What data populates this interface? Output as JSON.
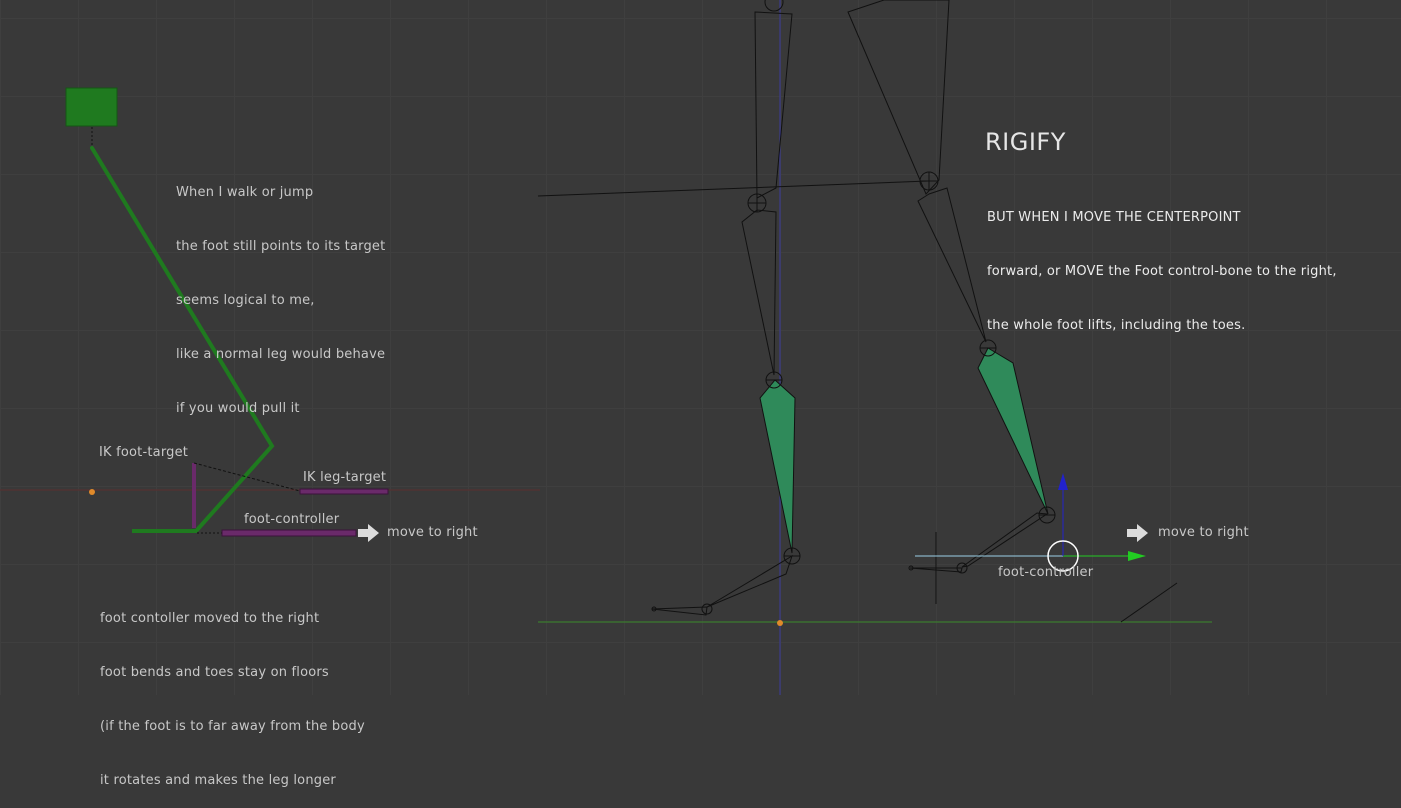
{
  "left_panel": {
    "note_top": [
      "When I walk or jump",
      "the foot still points to its target",
      "seems logical to me,",
      "like a normal leg would behave",
      "if you would pull it"
    ],
    "ik_foot_target_label": "IK foot-target",
    "ik_leg_target_label": "IK leg-target",
    "foot_controller_label": "foot-controller",
    "move_right_label": "move to right",
    "note_bottom": [
      "foot contoller moved to the right",
      "foot bends and toes stay on floors",
      "(if the foot is to far away from the body",
      "it rotates and makes the leg longer"
    ]
  },
  "right_panel": {
    "title": "RIGIFY",
    "note": [
      "BUT WHEN I MOVE THE CENTERPOINT",
      "forward, or MOVE the Foot control-bone to the right,",
      "the whole foot lifts, including the toes."
    ],
    "move_right_label": "move to right",
    "foot_controller_label": "foot-controller"
  },
  "colors": {
    "background": "#393939",
    "bone_green": "#1f7a1f",
    "target_purple": "#6a2a6a",
    "ik_bone_fill": "#2f8a5a",
    "axis_blue": "#2222cc",
    "axis_green": "#22cc22"
  }
}
